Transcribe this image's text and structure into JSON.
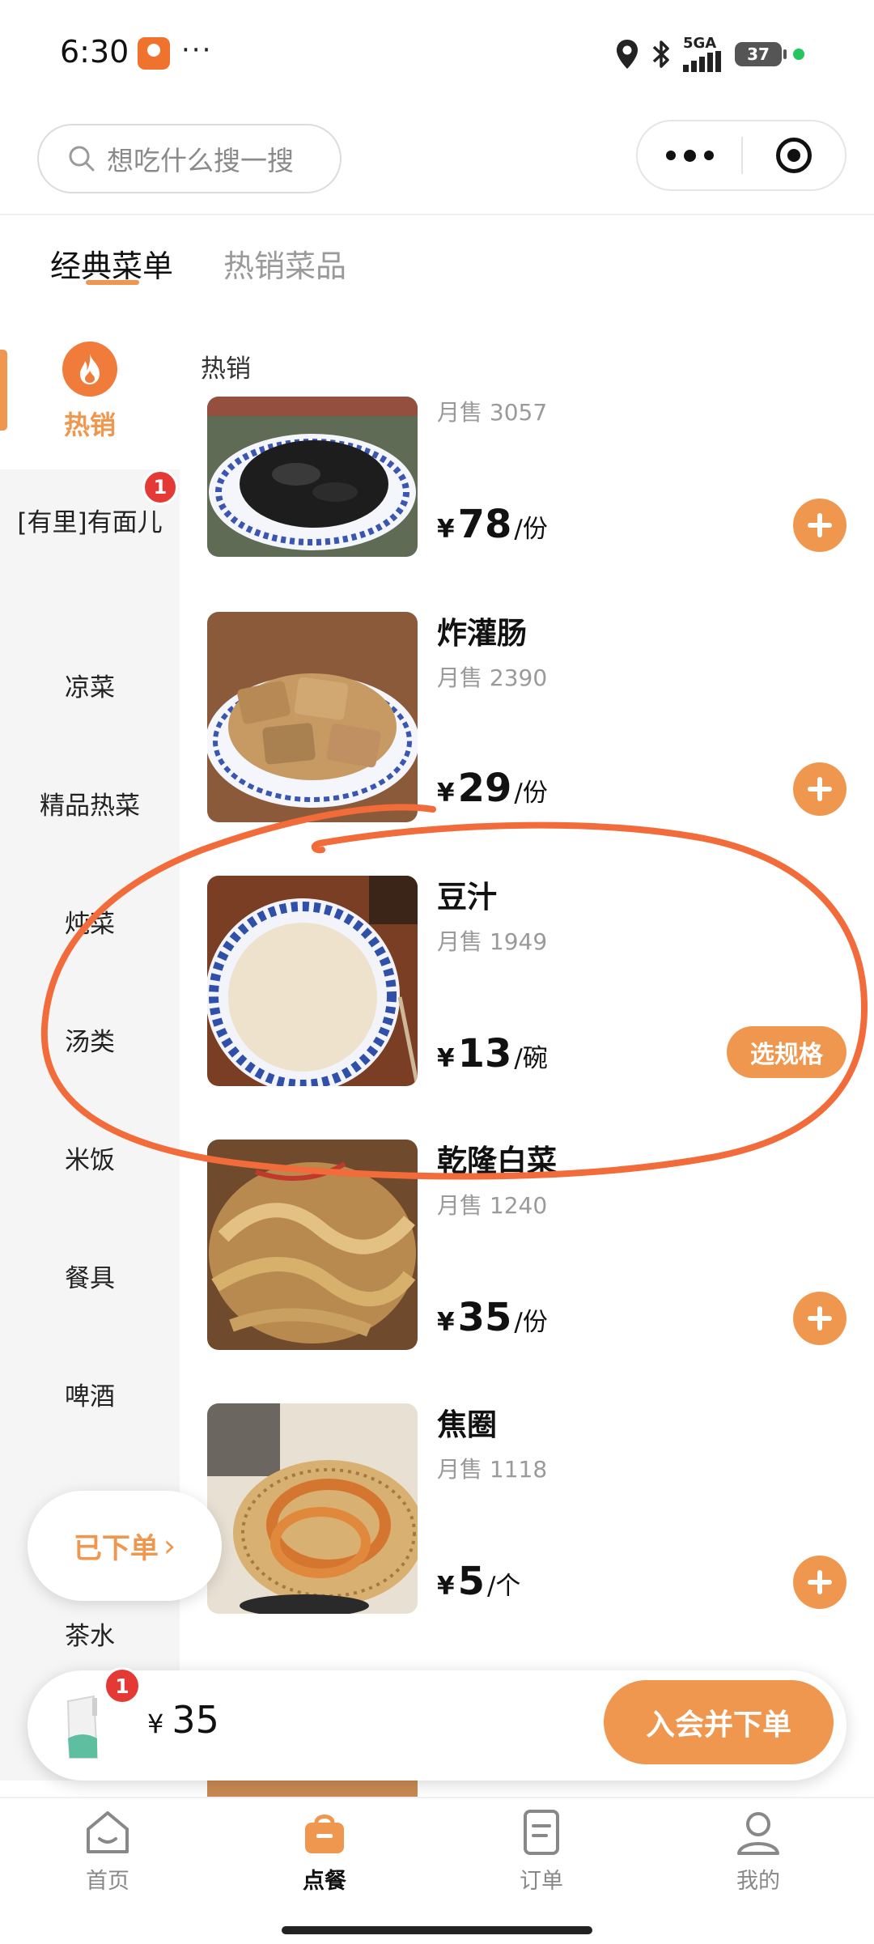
{
  "status_bar": {
    "time": "6:30",
    "overflow": "···",
    "network": "5GA",
    "battery": "37"
  },
  "search": {
    "placeholder": "想吃什么搜一搜"
  },
  "tabs": [
    {
      "label": "经典菜单",
      "active": true
    },
    {
      "label": "热销菜品",
      "active": false
    }
  ],
  "sidebar": {
    "active_label": "热销",
    "items": [
      {
        "label": "[有里]有面儿",
        "badge": "1"
      },
      {
        "label": "凉菜"
      },
      {
        "label": "精品热菜"
      },
      {
        "label": "炖菜"
      },
      {
        "label": "汤类"
      },
      {
        "label": "米饭"
      },
      {
        "label": "餐具"
      },
      {
        "label": "啤酒"
      },
      {
        "label": "茶水"
      }
    ]
  },
  "placed_order": {
    "label": "已下单",
    "chevron": "›"
  },
  "section_title": "热销",
  "products": [
    {
      "name": "",
      "sales": "月售 3057",
      "currency": "¥",
      "price": "78",
      "unit": "/份",
      "action": "add"
    },
    {
      "name": "炸灌肠",
      "sales": "月售 2390",
      "currency": "¥",
      "price": "29",
      "unit": "/份",
      "action": "add"
    },
    {
      "name": "豆汁",
      "sales": "月售 1949",
      "currency": "¥",
      "price": "13",
      "unit": "/碗",
      "action": "spec",
      "spec_label": "选规格"
    },
    {
      "name": "乾隆白菜",
      "sales": "月售 1240",
      "currency": "¥",
      "price": "35",
      "unit": "/份",
      "action": "add"
    },
    {
      "name": "焦圈",
      "sales": "月售 1118",
      "currency": "¥",
      "price": "5",
      "unit": "/个",
      "action": "add"
    }
  ],
  "cart": {
    "badge": "1",
    "currency": "¥",
    "total": "35",
    "checkout_label": "入会并下单"
  },
  "bottom_nav": [
    {
      "label": "首页",
      "icon": "home-icon",
      "active": false
    },
    {
      "label": "点餐",
      "icon": "bag-icon",
      "active": true
    },
    {
      "label": "订单",
      "icon": "order-icon",
      "active": false
    },
    {
      "label": "我的",
      "icon": "profile-icon",
      "active": false
    }
  ],
  "colors": {
    "accent": "#f0974f",
    "badge": "#e53935",
    "annotation": "#f26b3a"
  }
}
